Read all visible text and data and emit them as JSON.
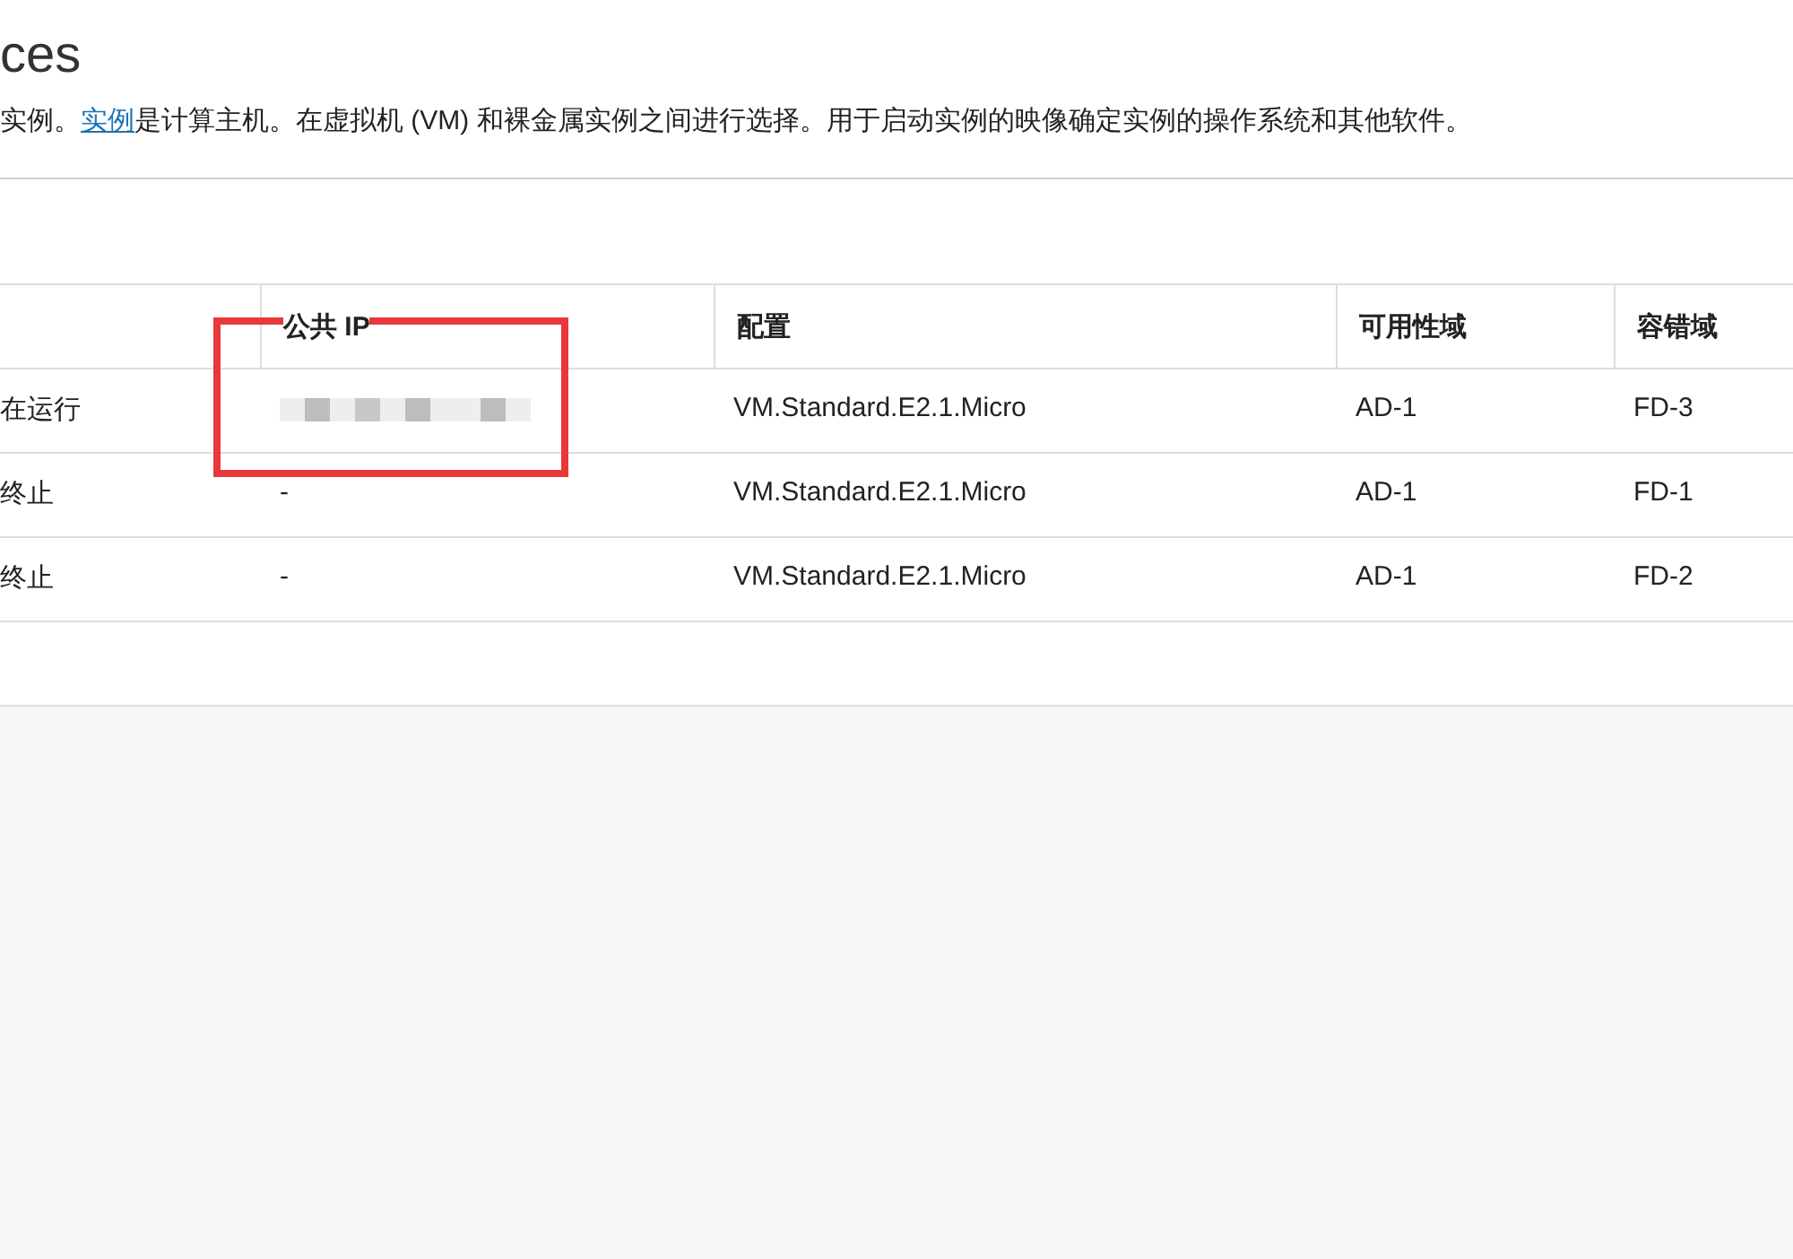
{
  "page": {
    "title": "ces",
    "description": {
      "before": "实例。",
      "link": "实例",
      "after": "是计算主机。在虚拟机 (VM) 和裸金属实例之间进行选择。用于启动实例的映像确定实例的操作系统和其他软件。"
    }
  },
  "table": {
    "columns": [
      "",
      "公共 IP",
      "配置",
      "可用性域",
      "容错域"
    ],
    "rows": [
      {
        "state": "在运行",
        "public_ip": {
          "kind": "redacted"
        },
        "shape": "VM.Standard.E2.1.Micro",
        "availability_domain": "AD-1",
        "fault_domain": "FD-3"
      },
      {
        "state": "终止",
        "public_ip": {
          "kind": "text",
          "text": "-"
        },
        "shape": "VM.Standard.E2.1.Micro",
        "availability_domain": "AD-1",
        "fault_domain": "FD-1"
      },
      {
        "state": "终止",
        "public_ip": {
          "kind": "text",
          "text": "-"
        },
        "shape": "VM.Standard.E2.1.Micro",
        "availability_domain": "AD-1",
        "fault_domain": "FD-2"
      }
    ]
  },
  "annotation": {
    "kind": "highlight-box"
  }
}
